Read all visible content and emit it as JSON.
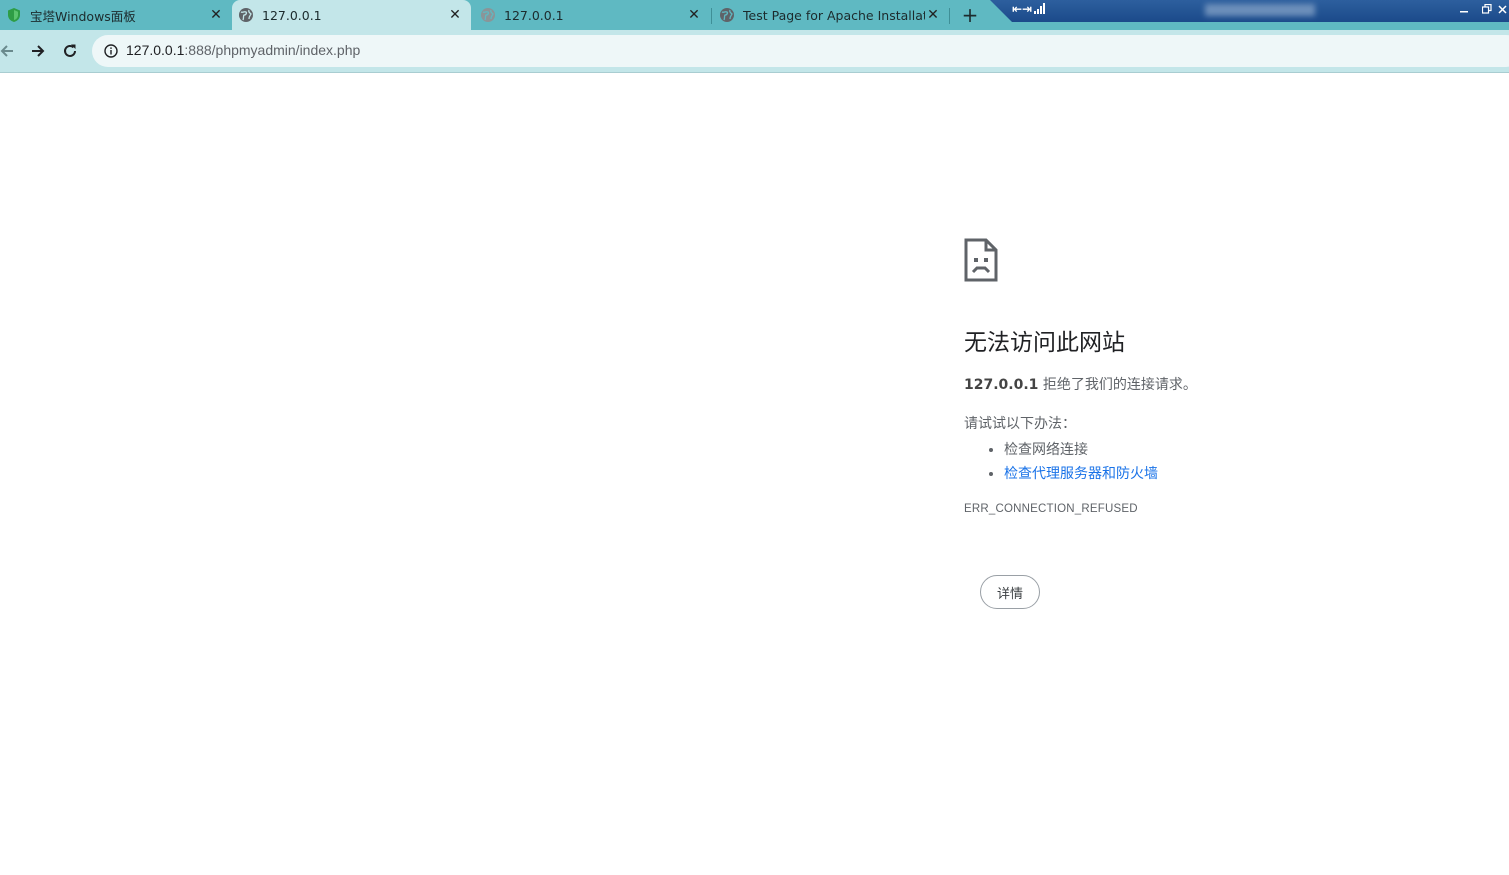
{
  "browser": {
    "tabs": [
      {
        "title": "宝塔Windows面板",
        "favicon": "shield-favicon",
        "active": false
      },
      {
        "title": "127.0.0.1",
        "favicon": "globe-favicon",
        "active": true
      },
      {
        "title": "127.0.0.1",
        "favicon": "globe-favicon",
        "active": false
      },
      {
        "title": "Test Page for Apache Installat",
        "favicon": "globe-favicon",
        "active": false
      }
    ],
    "close_glyph": "✕",
    "new_tab_glyph": "+",
    "remote_bar": {
      "indicator": "⇤⇥"
    },
    "address": {
      "host": "127.0.0.1",
      "path": ":888/phpmyadmin/index.php"
    }
  },
  "error_page": {
    "title": "无法访问此网站",
    "host": "127.0.0.1",
    "message": " 拒绝了我们的连接请求。",
    "try_label": "请试试以下办法：",
    "suggestions": [
      {
        "text": "检查网络连接",
        "link": false
      },
      {
        "text": "检查代理服务器和防火墙",
        "link": true
      }
    ],
    "error_code": "ERR_CONNECTION_REFUSED",
    "details_button": "详情"
  },
  "colors": {
    "tabstrip": "#5fb9c2",
    "active_tab": "#c3e6e9",
    "link": "#1a73e8",
    "remote_bar": "#1b4a8a"
  }
}
